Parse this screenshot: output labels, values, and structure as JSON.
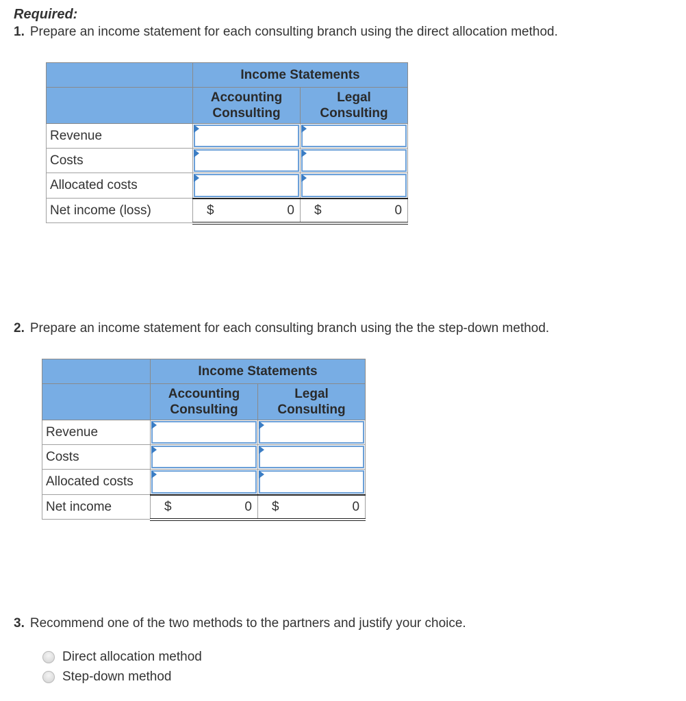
{
  "required_label": "Required:",
  "questions": [
    {
      "number": "1.",
      "text": "Prepare an income statement for each consulting branch using the direct allocation method."
    },
    {
      "number": "2.",
      "text": "Prepare an income statement for each consulting branch using the the step-down method."
    },
    {
      "number": "3.",
      "text": "Recommend one of the two methods to the partners and justify your choice."
    }
  ],
  "table1": {
    "title": "Income Statements",
    "columns": [
      {
        "line1": "Accounting",
        "line2": "Consulting"
      },
      {
        "line1": "Legal",
        "line2": "Consulting"
      }
    ],
    "rows": [
      {
        "label": "Revenue",
        "values": [
          "",
          ""
        ]
      },
      {
        "label": "Costs",
        "values": [
          "",
          ""
        ]
      },
      {
        "label": "Allocated costs",
        "values": [
          "",
          ""
        ]
      }
    ],
    "total": {
      "label": "Net income (loss)",
      "currency": "$",
      "values": [
        "0",
        "0"
      ]
    }
  },
  "table2": {
    "title": "Income Statements",
    "columns": [
      {
        "line1": "Accounting",
        "line2": "Consulting"
      },
      {
        "line1": "Legal",
        "line2": "Consulting"
      }
    ],
    "rows": [
      {
        "label": "Revenue",
        "values": [
          "",
          ""
        ]
      },
      {
        "label": "Costs",
        "values": [
          "",
          ""
        ]
      },
      {
        "label": "Allocated costs",
        "values": [
          "",
          ""
        ]
      }
    ],
    "total": {
      "label": "Net income",
      "currency": "$",
      "values": [
        "0",
        "0"
      ]
    }
  },
  "recommendation": {
    "options": [
      {
        "label": "Direct allocation method",
        "selected": false
      },
      {
        "label": "Step-down method",
        "selected": false
      }
    ]
  },
  "colors": {
    "header_bg": "#78ade4",
    "input_border": "#6a9fd8",
    "input_flag": "#3b7dc4"
  }
}
